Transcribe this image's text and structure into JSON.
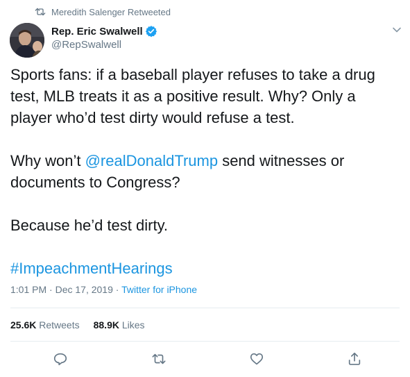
{
  "retweet": {
    "icon": "retweet-icon",
    "text": "Meredith Salenger Retweeted"
  },
  "author": {
    "display_name": "Rep. Eric Swalwell",
    "handle": "@RepSwalwell",
    "verified_icon": "verified-badge-icon"
  },
  "tweet": {
    "para1": "Sports fans: if a baseball player refuses to take a drug test, MLB treats it as a positive result. Why? Only a player who’d test dirty would refuse a test.",
    "para2_prefix": "Why won’t ",
    "mention": "@realDonaldTrump",
    "para2_suffix": " send witnesses or documents to Congress?",
    "para3": "Because he’d test dirty.",
    "hashtag": "#ImpeachmentHearings"
  },
  "meta": {
    "time": "1:01 PM",
    "separator1": " · ",
    "date": "Dec 17, 2019",
    "separator2": " · ",
    "source": "Twitter for iPhone"
  },
  "stats": {
    "retweets_count": "25.6K",
    "retweets_label": "Retweets",
    "likes_count": "88.9K",
    "likes_label": "Likes"
  },
  "actions": {
    "reply_icon": "reply-icon",
    "retweet_icon": "retweet-icon",
    "like_icon": "heart-icon",
    "share_icon": "share-icon"
  },
  "colors": {
    "link": "#1b95e0",
    "secondary_text": "#657786",
    "primary_text": "#14171a",
    "divider": "#e6ecf0"
  }
}
